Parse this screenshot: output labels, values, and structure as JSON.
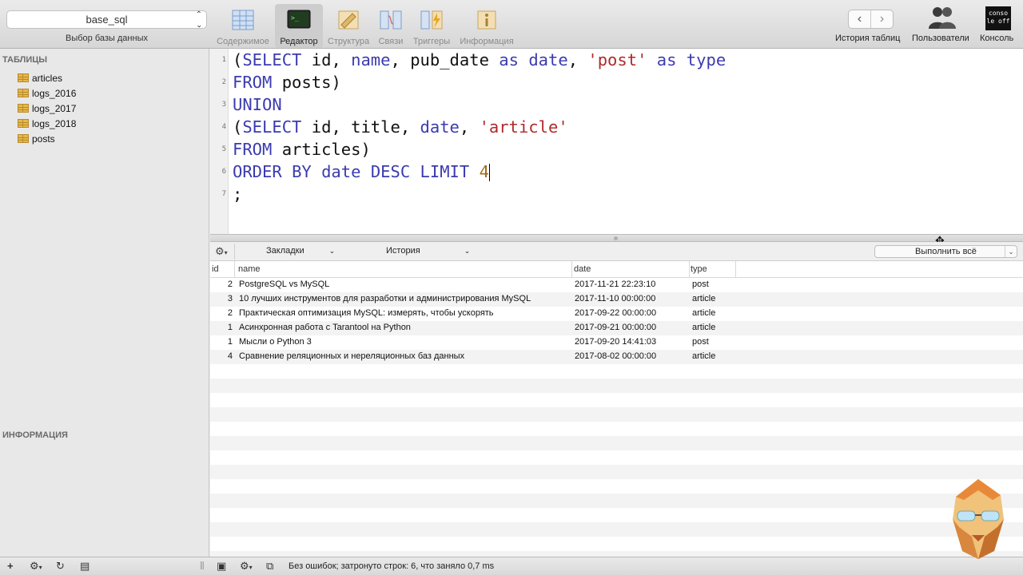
{
  "toolbar": {
    "db_selected": "base_sql",
    "db_caption": "Выбор базы данных",
    "buttons": [
      {
        "label": "Содержимое",
        "icon": "table-content-icon",
        "active": false
      },
      {
        "label": "Редактор",
        "icon": "terminal-icon",
        "active": true
      },
      {
        "label": "Структура",
        "icon": "structure-icon",
        "active": false
      },
      {
        "label": "Связи",
        "icon": "relations-icon",
        "active": false
      },
      {
        "label": "Триггеры",
        "icon": "triggers-icon",
        "active": false
      },
      {
        "label": "Информация",
        "icon": "info-icon",
        "active": false
      }
    ],
    "history_label": "История таблиц",
    "users_label": "Пользователи",
    "console_label": "Консоль",
    "console_icon_text": "conso le off"
  },
  "sidebar": {
    "tables_heading": "ТАБЛИЦЫ",
    "tables": [
      "articles",
      "logs_2016",
      "logs_2017",
      "logs_2018",
      "posts"
    ],
    "info_heading": "ИНФОРМАЦИЯ"
  },
  "editor": {
    "line_numbers": [
      "1",
      "2",
      "3",
      "4",
      "5",
      "6",
      "7"
    ],
    "lines": [
      "(SELECT id, name, pub_date as date, 'post' as type",
      "FROM posts)",
      "UNION",
      "(SELECT id, title, date, 'article'",
      "FROM articles)",
      "ORDER BY date DESC LIMIT 4",
      ";"
    ]
  },
  "query_bar": {
    "bookmarks_label": "Закладки",
    "history_label": "История",
    "run_all_label": "Выполнить всё"
  },
  "results": {
    "columns": [
      "id",
      "name",
      "date",
      "type"
    ],
    "rows": [
      {
        "id": "2",
        "name": "PostgreSQL vs MySQL",
        "date": "2017-11-21 22:23:10",
        "type": "post"
      },
      {
        "id": "3",
        "name": "10 лучших инструментов для разработки и администрирования MySQL",
        "date": "2017-11-10 00:00:00",
        "type": "article"
      },
      {
        "id": "2",
        "name": "Практическая оптимизация MySQL: измерять, чтобы ускорять",
        "date": "2017-09-22 00:00:00",
        "type": "article"
      },
      {
        "id": "1",
        "name": "Асинхронная работа с Tarantool на Python",
        "date": "2017-09-21 00:00:00",
        "type": "article"
      },
      {
        "id": "1",
        "name": "Мысли о Python 3",
        "date": "2017-09-20 14:41:03",
        "type": "post"
      },
      {
        "id": "4",
        "name": "Сравнение реляционных и нереляционных баз данных",
        "date": "2017-08-02 00:00:00",
        "type": "article"
      }
    ]
  },
  "status": {
    "message": "Без ошибок; затронуто строк: 6, что заняло 0,7 ms"
  },
  "colors": {
    "keyword": "#3b3bb0",
    "string": "#b02a2a",
    "number": "#a46a1a"
  }
}
